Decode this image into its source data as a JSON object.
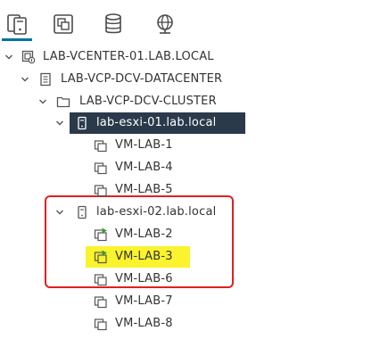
{
  "tabs": [
    {
      "name": "hosts-and-clusters",
      "icon": "hosts-clusters-icon",
      "active": true
    },
    {
      "name": "vms-and-templates",
      "icon": "vms-templates-icon",
      "active": false
    },
    {
      "name": "storage",
      "icon": "database-icon",
      "active": false
    },
    {
      "name": "networking",
      "icon": "globe-icon",
      "active": false
    }
  ],
  "colors": {
    "accent": "#0072a3",
    "selected_row": "#2b3a4a",
    "highlight": "#fbf32d",
    "annotation": "#e02020",
    "powered_on": "#3c9a36"
  },
  "tree": {
    "vcenter": {
      "label": "LAB-VCENTER-01.LAB.LOCAL",
      "icon": "vcenter-icon",
      "expanded": true
    },
    "datacenter": {
      "label": "LAB-VCP-DCV-DATACENTER",
      "icon": "datacenter-icon",
      "expanded": true
    },
    "cluster": {
      "label": "LAB-VCP-DCV-CLUSTER",
      "icon": "folder-icon",
      "expanded": true
    },
    "host1": {
      "label": "lab-esxi-01.lab.local",
      "icon": "host-icon",
      "expanded": true,
      "selected": true,
      "vms": [
        {
          "label": "VM-LAB-1",
          "powered_on": false
        },
        {
          "label": "VM-LAB-4",
          "powered_on": false
        },
        {
          "label": "VM-LAB-5",
          "powered_on": false
        }
      ]
    },
    "host2": {
      "label": "lab-esxi-02.lab.local",
      "icon": "host-icon",
      "expanded": true,
      "selected": false,
      "vms": [
        {
          "label": "VM-LAB-2",
          "powered_on": true
        },
        {
          "label": "VM-LAB-3",
          "powered_on": true,
          "highlighted": true
        },
        {
          "label": "VM-LAB-6",
          "powered_on": false
        }
      ]
    },
    "orphan_vms": [
      {
        "label": "VM-LAB-7",
        "powered_on": false
      },
      {
        "label": "VM-LAB-8",
        "powered_on": false
      }
    ]
  }
}
